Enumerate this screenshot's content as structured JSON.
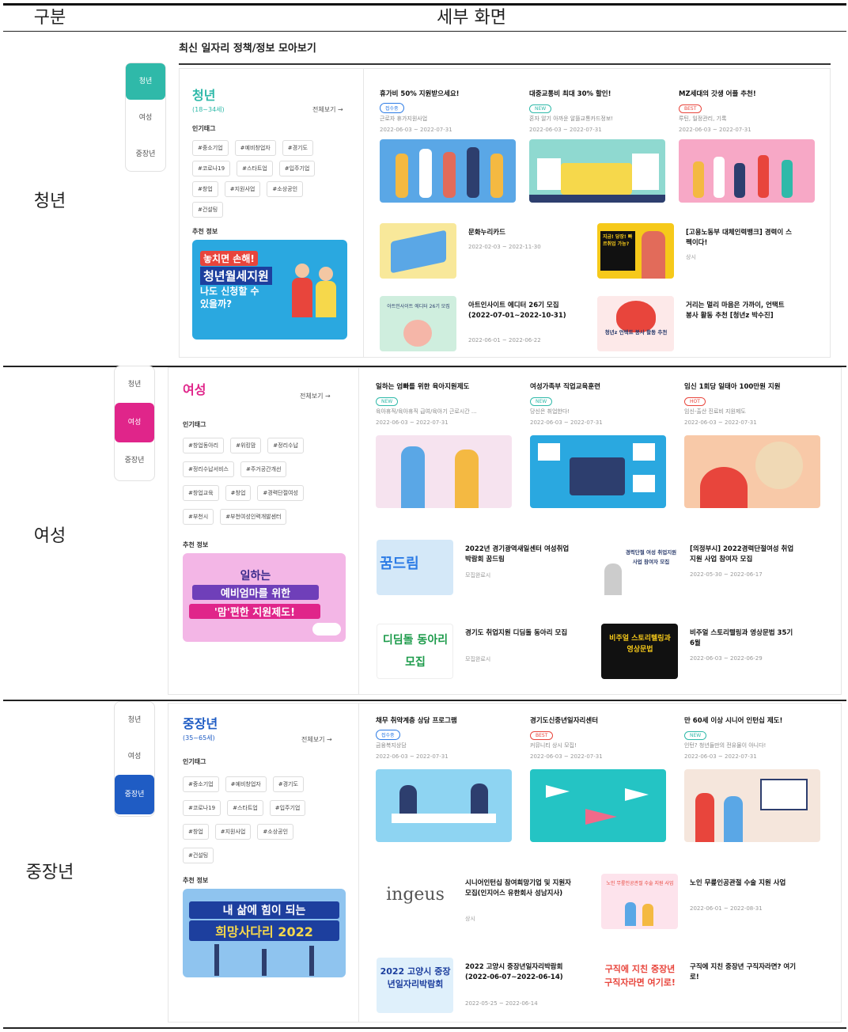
{
  "table_header": {
    "col1": "구분",
    "col2": "세부 화면"
  },
  "main_title": "최신 일자리 정책/정보 모아보기",
  "side_tabs": [
    "청년",
    "여성",
    "중장년"
  ],
  "colors": {
    "youth": "#2fb9a9",
    "women": "#e0258a",
    "middle": "#1f5cc4",
    "accent_blue": "#2c7be5"
  },
  "rows": [
    {
      "label": "청년",
      "category": {
        "title": "청년",
        "age": "(18~34세)",
        "more": "전체보기 →",
        "tags_label": "인기태그",
        "tags": [
          "#중소기업",
          "#예비창업자",
          "#경기도",
          "#코로나19",
          "#스타트업",
          "#입주기업",
          "#창업",
          "#지원사업",
          "#소상공인",
          "#건설팅"
        ],
        "rec_label": "추천 정보",
        "banner": {
          "line1": "놓치면 손해!",
          "line2": "청년월세지원",
          "line3": "나도 신청할 수",
          "line4": "있을까?"
        }
      },
      "cards": [
        {
          "title": "휴가비 50% 지원받으세요!",
          "badge": "접수중",
          "sub": "근로자 휴가지원사업",
          "date": "2022-06-03 ~ 2022-07-31"
        },
        {
          "title": "대중교통비 최대 30% 할인!",
          "badge": "NEW",
          "sub": "혼자 알기 아까운 알뜰교통카드정보!",
          "date": "2022-06-03 ~ 2022-07-31"
        },
        {
          "title": "MZ세대의 갓생 어플 추천!",
          "badge": "BEST",
          "sub": "루틴, 일정관리, 기록",
          "date": "2022-06-03 ~ 2022-07-31"
        }
      ],
      "minis": [
        {
          "title": "문화누리카드",
          "date": "2022-02-03 ~ 2022-11-30"
        },
        {
          "title": "[고용노동부 대체인력뱅크] 경력이 스펙이다!",
          "date": "상시",
          "img_text": "지금! 당장! 빠르취업 가능?"
        },
        {
          "title": "아트인사이트 에디터 26기 모집 (2022-07-01~2022-10-31)",
          "date": "2022-06-01 ~ 2022-06-22",
          "img_text": "아트인사이트 에디터 26기 모집"
        },
        {
          "title": "거리는 멀리 마음은 가까이, 언택트 봉사 활동 추천 [청년z 박수진]",
          "date": "",
          "img_text": "청년z 언택트 봉사 활동 추천"
        }
      ]
    },
    {
      "label": "여성",
      "category": {
        "title": "여성",
        "age": "",
        "more": "전체보기 →",
        "tags_label": "인기태그",
        "tags": [
          "#창업동아리",
          "#위킹맘",
          "#정리수납",
          "#정리수납서비스",
          "#주거공간개선",
          "#창업교육",
          "#창업",
          "#경력단절여성",
          "#부천시",
          "#부천여성인력개발센터"
        ],
        "rec_label": "추천 정보",
        "banner": {
          "line1": "일하는",
          "line2": "예비엄마를 위한",
          "line3": "'맘'편한 지원제도!"
        }
      },
      "cards": [
        {
          "title": "일하는 엄빠를 위한 육아지원제도",
          "badge": "NEW",
          "sub": "육아휴직/육아휴직 급여/육아기 근로시간 ...",
          "date": "2022-06-03 ~ 2022-07-31"
        },
        {
          "title": "여성가족부 직업교육훈련",
          "badge": "NEW",
          "sub": "당신은 취업한다!",
          "date": "2022-06-03 ~ 2022-07-31"
        },
        {
          "title": "임신 1회당 일태아 100만원 지원",
          "badge": "HOT",
          "sub": "임신-출산 진료비 지원제도",
          "date": "2022-06-03 ~ 2022-07-31"
        }
      ],
      "minis": [
        {
          "title": "2022년 경기광역새일센터 여성취업 박람회 꿈드림",
          "date": "모집완료시",
          "img_text": "꿈드림"
        },
        {
          "title": "[의정부시] 2022경력단절여성 취업지원 사업 참여자 모집",
          "date": "2022-05-30 ~ 2022-06-17",
          "img_text": "경력단절 여성 취업지원사업 참여자 모집"
        },
        {
          "title": "경기도 취업지원 디딤돌 동아리 모집",
          "date": "모집완료시",
          "img_text": "디딤돌 동아리 모집"
        },
        {
          "title": "비주얼 스토리텔링과 영상문법 35기 6월",
          "date": "2022-06-03 ~ 2022-06-29",
          "img_text": "비주얼 스토리텔링과 영상문법"
        }
      ]
    },
    {
      "label": "중장년",
      "category": {
        "title": "중장년",
        "age": "(35~65세)",
        "more": "전체보기 →",
        "tags_label": "인기태그",
        "tags": [
          "#중소기업",
          "#예비창업자",
          "#경기도",
          "#코로나19",
          "#스타트업",
          "#입주기업",
          "#창업",
          "#지원사업",
          "#소상공인",
          "#건설팅"
        ],
        "rec_label": "추천 정보",
        "banner": {
          "line1": "내 삶에 힘이 되는",
          "line2": "희망사다리 2022"
        }
      },
      "cards": [
        {
          "title": "채무 취약계층 상담 프로그램",
          "badge": "접수중",
          "sub": "금융복지상담",
          "date": "2022-06-03 ~ 2022-07-31"
        },
        {
          "title": "경기도신중년일자리센터",
          "badge": "BEST",
          "sub": "커뮤니티 상시 모집!",
          "date": "2022-06-03 ~ 2022-07-31"
        },
        {
          "title": "만 60세 이상 시니어 인턴십 제도!",
          "badge": "NEW",
          "sub": "인턴? 청년들만의 전유물이 아니다!",
          "date": "2022-06-03 ~ 2022-07-31"
        }
      ],
      "minis": [
        {
          "title": "시니어인턴십 참여희망기업 및 지원자 모집(인지어스 유한회사 성남지사)",
          "date": "상시",
          "img_text": "ingeus"
        },
        {
          "title": "노인 무릎인공관절 수술 지원 사업",
          "date": "2022-06-01 ~ 2022-08-31",
          "img_text": "노인 무릎인공관절 수술 지원 사업"
        },
        {
          "title": "2022 고양시 중장년일자리박람회 (2022-06-07~2022-06-14)",
          "date": "2022-05-25 ~ 2022-06-14",
          "img_text": "2022 고양시 중장년일자리박람회"
        },
        {
          "title": "구직에 지친 중장년 구직자라면? 여기로!",
          "date": "",
          "img_text": "구직에 지친 중장년 구직자라면 여기로!"
        }
      ]
    }
  ]
}
